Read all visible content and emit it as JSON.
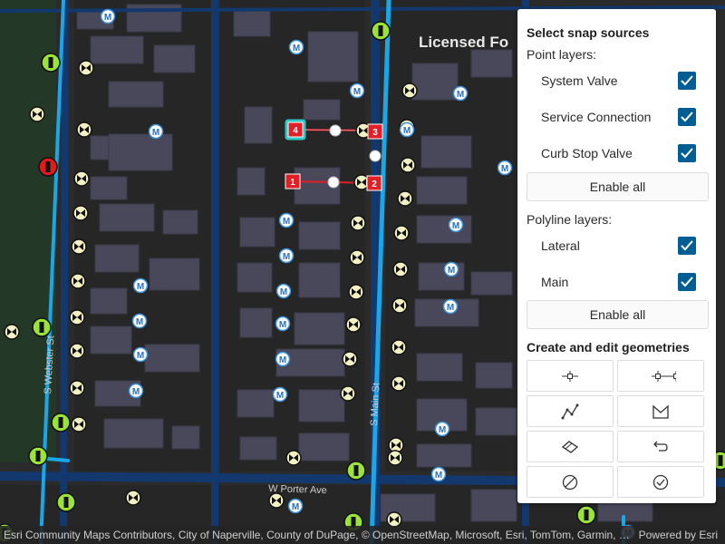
{
  "map": {
    "labels": {
      "licensed": "Licensed Fo",
      "s_webster": "S Webster St",
      "s_main": "S Main St",
      "w_porter": "W Porter Ave"
    },
    "vertex_labels": [
      "1",
      "2",
      "3",
      "4"
    ],
    "meter_glyph": "M",
    "colors": {
      "background": "#2b2b2b",
      "block": "#252525",
      "street": "#12386e",
      "main_line": "#1aa7e8",
      "building": "#48485a",
      "valve_fill": "#f3f1c4",
      "service_connection": "#ffffff",
      "curb_stop_green": "#9be336",
      "curb_stop_red": "#e21a1a",
      "vertex_marker": "#e01f26",
      "selected_highlight": "#2ec8c6"
    }
  },
  "panel": {
    "snap_title": "Select snap sources",
    "point_layers_label": "Point layers:",
    "point_layers": [
      {
        "name": "System Valve",
        "checked": true
      },
      {
        "name": "Service Connection",
        "checked": true
      },
      {
        "name": "Curb Stop Valve",
        "checked": true
      }
    ],
    "enable_all_points": "Enable all",
    "polyline_layers_label": "Polyline layers:",
    "polyline_layers": [
      {
        "name": "Lateral",
        "checked": true
      },
      {
        "name": "Main",
        "checked": true
      }
    ],
    "enable_all_polylines": "Enable all",
    "edit_title": "Create and edit geometries",
    "tools": [
      {
        "icon": "point-tool-icon"
      },
      {
        "icon": "multipoint-tool-icon"
      },
      {
        "icon": "polyline-tool-icon"
      },
      {
        "icon": "polygon-tool-icon"
      },
      {
        "icon": "erase-tool-icon"
      },
      {
        "icon": "undo-tool-icon"
      },
      {
        "icon": "cancel-tool-icon"
      },
      {
        "icon": "save-tool-icon"
      }
    ]
  },
  "attribution": {
    "text": "Esri Community Maps Contributors, City of Naperville, County of DuPage, © OpenStreetMap, Microsoft, Esri, TomTom, Garmin, SafeGraph, GeoTechnologies, Inc, METI/NASA, USGS, EPA, NPS, US Census Bureau, USDA, USFWS",
    "powered": "Powered by Esri"
  }
}
